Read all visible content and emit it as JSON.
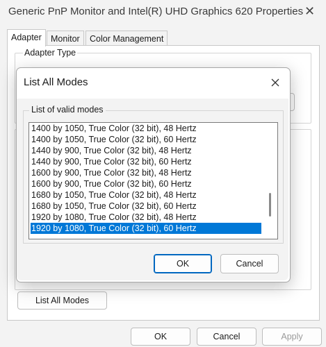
{
  "window": {
    "title": "Generic PnP Monitor and Intel(R) UHD Graphics 620 Properties"
  },
  "tabs": [
    "Adapter",
    "Monitor",
    "Color Management"
  ],
  "adapter": {
    "adapter_type_label": "Adapter Type",
    "list_all_modes_button": "List All Modes"
  },
  "footer": {
    "ok": "OK",
    "cancel": "Cancel",
    "apply": "Apply"
  },
  "dialog": {
    "title": "List All Modes",
    "group_label": "List of valid modes",
    "modes": [
      "1400 by 1050, True Color (32 bit), 48 Hertz",
      "1400 by 1050, True Color (32 bit), 60 Hertz",
      "1440 by 900, True Color (32 bit), 48 Hertz",
      "1440 by 900, True Color (32 bit), 60 Hertz",
      "1600 by 900, True Color (32 bit), 48 Hertz",
      "1600 by 900, True Color (32 bit), 60 Hertz",
      "1680 by 1050, True Color (32 bit), 48 Hertz",
      "1680 by 1050, True Color (32 bit), 60 Hertz",
      "1920 by 1080, True Color (32 bit), 48 Hertz",
      "1920 by 1080, True Color (32 bit), 60 Hertz"
    ],
    "selected_index": 9,
    "ok": "OK",
    "cancel": "Cancel"
  },
  "colors": {
    "selection": "#0078d7",
    "accent": "#0067c0"
  },
  "icons": [
    "close-icon",
    "dialog-close-icon"
  ]
}
